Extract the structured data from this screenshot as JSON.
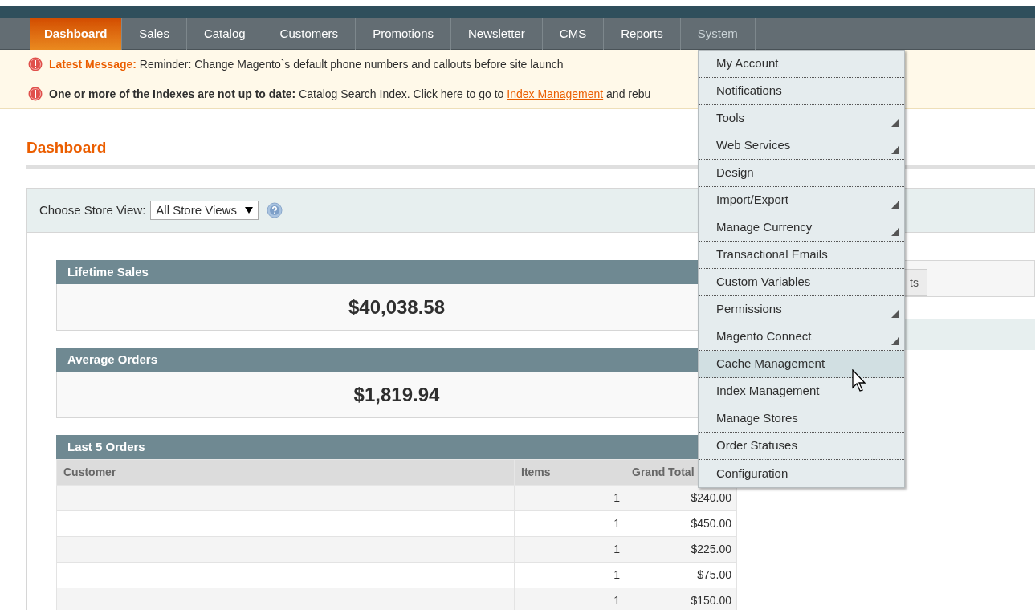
{
  "nav": [
    {
      "label": "Dashboard",
      "selected": true,
      "expanded": false
    },
    {
      "label": "Sales",
      "selected": false,
      "expanded": false
    },
    {
      "label": "Catalog",
      "selected": false,
      "expanded": false
    },
    {
      "label": "Customers",
      "selected": false,
      "expanded": false
    },
    {
      "label": "Promotions",
      "selected": false,
      "expanded": false
    },
    {
      "label": "Newsletter",
      "selected": false,
      "expanded": false
    },
    {
      "label": "CMS",
      "selected": false,
      "expanded": false
    },
    {
      "label": "Reports",
      "selected": false,
      "expanded": false
    },
    {
      "label": "System",
      "selected": false,
      "expanded": true
    }
  ],
  "messages": [
    {
      "kind": "latest",
      "title": "Latest Message:",
      "text": "Reminder: Change Magento`s default phone numbers and callouts before site launch"
    },
    {
      "kind": "index",
      "title": "One or more of the Indexes are not up to date:",
      "text": "Catalog Search Index. Click here to go to",
      "link": "Index Management",
      "after": "and rebu"
    }
  ],
  "page_title": "Dashboard",
  "store_switcher": {
    "label": "Choose Store View:",
    "value": "All Store Views"
  },
  "boxes": [
    {
      "title": "Lifetime Sales",
      "value": "$40,038.58"
    },
    {
      "title": "Average Orders",
      "value": "$1,819.94"
    }
  ],
  "last_orders": {
    "title": "Last 5 Orders",
    "columns": [
      "Customer",
      "Items",
      "Grand Total"
    ],
    "rows": [
      [
        "",
        "1",
        "$240.00"
      ],
      [
        "",
        "1",
        "$450.00"
      ],
      [
        "",
        "1",
        "$225.00"
      ],
      [
        "",
        "1",
        "$75.00"
      ],
      [
        "",
        "1",
        "$150.00"
      ]
    ]
  },
  "graph_tab": "ts",
  "system_menu": [
    {
      "label": "My Account",
      "submenu": false,
      "selected": false
    },
    {
      "label": "Notifications",
      "submenu": false,
      "selected": false
    },
    {
      "label": "Tools",
      "submenu": true,
      "selected": false
    },
    {
      "label": "Web Services",
      "submenu": true,
      "selected": false
    },
    {
      "label": "Design",
      "submenu": false,
      "selected": false
    },
    {
      "label": "Import/Export",
      "submenu": true,
      "selected": false
    },
    {
      "label": "Manage Currency",
      "submenu": true,
      "selected": false
    },
    {
      "label": "Transactional Emails",
      "submenu": false,
      "selected": false
    },
    {
      "label": "Custom Variables",
      "submenu": false,
      "selected": false
    },
    {
      "label": "Permissions",
      "submenu": true,
      "selected": false
    },
    {
      "label": "Magento Connect",
      "submenu": true,
      "selected": false
    },
    {
      "label": "Cache Management",
      "submenu": false,
      "selected": true
    },
    {
      "label": "Index Management",
      "submenu": false,
      "selected": false
    },
    {
      "label": "Manage Stores",
      "submenu": false,
      "selected": false
    },
    {
      "label": "Order Statuses",
      "submenu": false,
      "selected": false
    },
    {
      "label": "Configuration",
      "submenu": false,
      "selected": false
    }
  ]
}
